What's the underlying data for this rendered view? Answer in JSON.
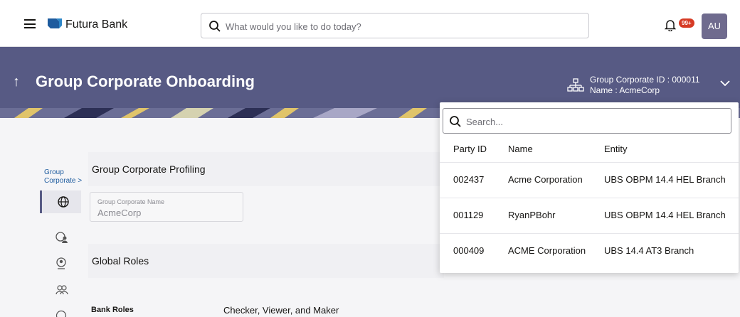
{
  "topbar": {
    "brand": "Futura Bank",
    "search_placeholder": "What would you like to do today?",
    "notification_badge": "99+",
    "avatar_initials": "AU"
  },
  "header": {
    "back_icon": "↑",
    "title": "Group Corporate Onboarding",
    "gc_id_line": "Group Corporate ID : 000011",
    "gc_name_line": "Name : AcmeCorp"
  },
  "breadcrumb": {
    "line1": "Group",
    "line2": "Corporate >"
  },
  "sections": {
    "profiling": "Group Corporate Profiling",
    "global_roles": "Global Roles"
  },
  "gc_name_field": {
    "label": "Group Corporate Name",
    "value": "AcmeCorp"
  },
  "bank_roles": {
    "label": "Bank Roles",
    "value": "Checker, Viewer, and Maker"
  },
  "dropdown": {
    "search_placeholder": "Search...",
    "columns": [
      "Party ID",
      "Name",
      "Entity"
    ],
    "rows": [
      {
        "party_id": "002437",
        "name": "Acme Corporation",
        "entity": "UBS OBPM 14.4 HEL Branch"
      },
      {
        "party_id": "001129",
        "name": "RyanPBohr",
        "entity": "UBS OBPM 14.4 HEL Branch"
      },
      {
        "party_id": "000409",
        "name": "ACME Corporation",
        "entity": "UBS 14.4 AT3 Branch"
      }
    ]
  },
  "colors": {
    "header_bg": "#575a84",
    "badge": "#d63b25",
    "avatar_bg": "#6f6b8e"
  }
}
